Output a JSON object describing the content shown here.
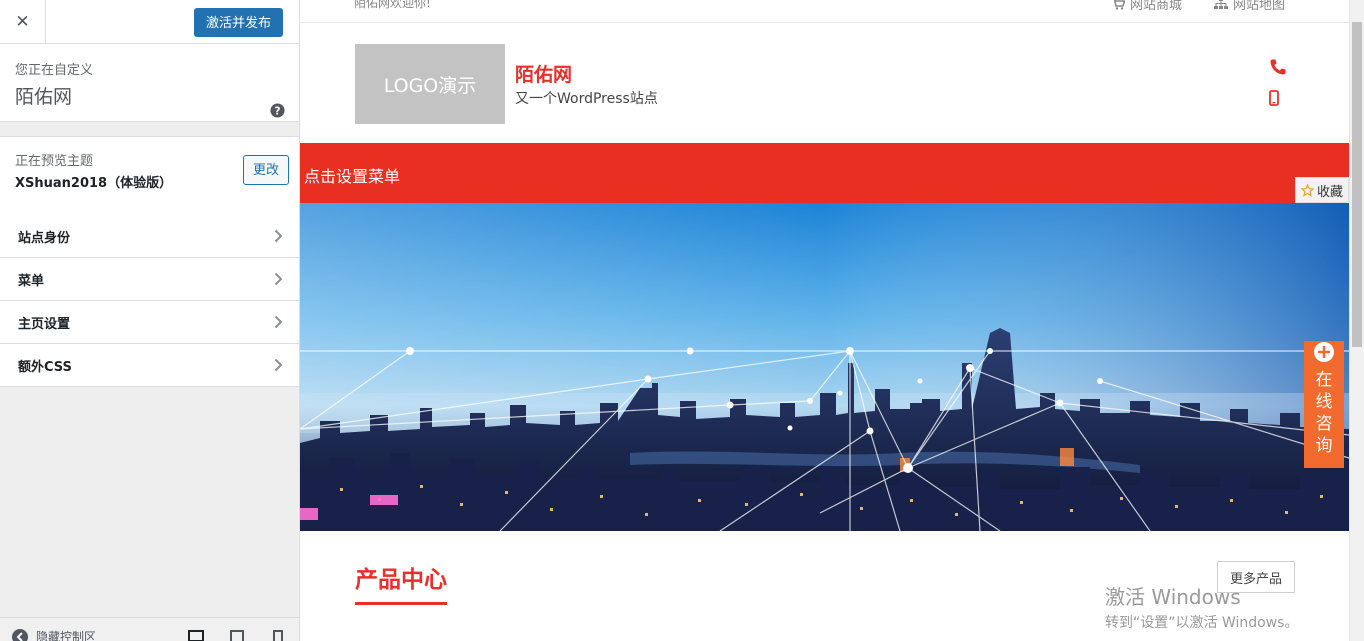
{
  "panel": {
    "close_icon": "close-icon",
    "publish_label": "激活并发布",
    "customizing_label": "您正在自定义",
    "site_name": "陌佑网",
    "help_icon": "help-icon",
    "previewing_label": "正在预览主题",
    "theme_name": "XShuan2018（体验版）",
    "change_label": "更改",
    "sections": [
      {
        "label": "站点身份"
      },
      {
        "label": "菜单"
      },
      {
        "label": "主页设置"
      },
      {
        "label": "额外CSS"
      }
    ],
    "footer": {
      "hide_controls_label": "隐藏控制区"
    }
  },
  "site": {
    "welcome": "陌佑网欢迎你!",
    "topbar_links": [
      {
        "label": "网站商城",
        "icon": "cart-icon"
      },
      {
        "label": "网站地图",
        "icon": "sitemap-icon"
      }
    ],
    "logo_text": "LOGO演示",
    "name": "陌佑网",
    "tagline": "又一个WordPress站点",
    "nav_label": "点击设置菜单",
    "products_title": "产品中心",
    "more_products": "更多产品",
    "bookmark_label": "收藏",
    "consult_label": "在线咨询"
  },
  "overlay": {
    "activate_title": "激活 Windows",
    "activate_sub": "转到“设置”以激活 Windows。"
  },
  "colors": {
    "accent": "#e92f22",
    "wp_blue": "#2271b1",
    "consult": "#f26a2d"
  }
}
